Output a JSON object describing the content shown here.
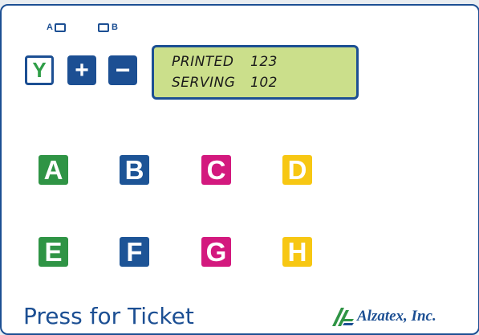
{
  "mode_indicators": {
    "a_label": "A",
    "b_label": "B"
  },
  "controls": {
    "y_label": "Y",
    "plus_label": "+",
    "minus_label": "−"
  },
  "display": {
    "printed_label": "PRINTED",
    "printed_value": "123",
    "serving_label": "SERVING",
    "serving_value": "102"
  },
  "service_buttons": [
    {
      "label": "A",
      "color": "#2f9445"
    },
    {
      "label": "B",
      "color": "#1d5496"
    },
    {
      "label": "C",
      "color": "#d3197e"
    },
    {
      "label": "D",
      "color": "#f7c713"
    },
    {
      "label": "E",
      "color": "#2f9445"
    },
    {
      "label": "F",
      "color": "#1d5496"
    },
    {
      "label": "G",
      "color": "#d3197e"
    },
    {
      "label": "H",
      "color": "#f7c713"
    }
  ],
  "footer": {
    "prompt": "Press for Ticket",
    "brand": "Alzatex, Inc."
  },
  "colors": {
    "frame": "#1c4f93",
    "lcd_background": "#cbdf8b"
  },
  "icons": {
    "logo": "alzatex-logo-icon"
  }
}
